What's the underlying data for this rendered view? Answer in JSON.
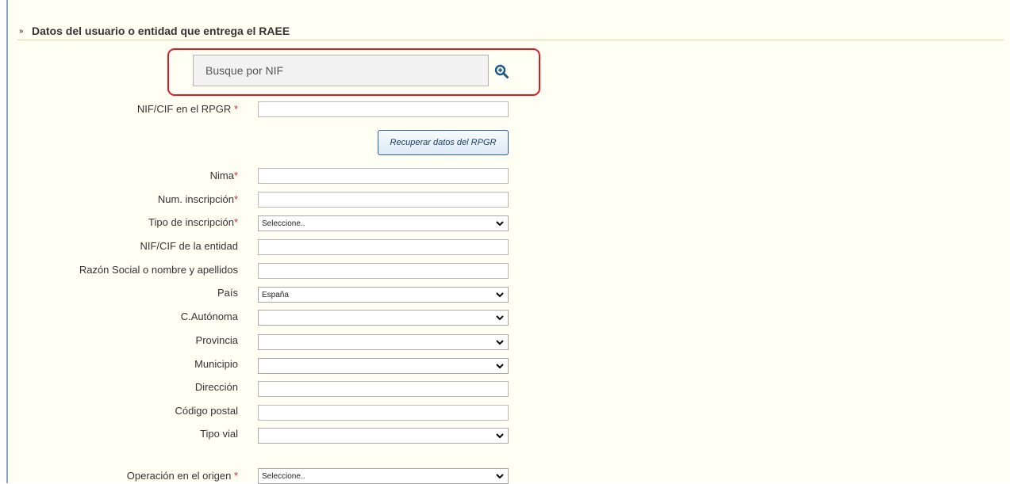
{
  "section": {
    "title": "Datos del usuario o entidad que entrega el RAEE"
  },
  "search": {
    "placeholder": "Busque por NIF"
  },
  "fields": {
    "nif_rpgr": {
      "label": "NIF/CIF en el RPGR",
      "req": "*",
      "value": ""
    },
    "recover_button": "Recuperar datos del RPGR",
    "nima": {
      "label": "Nima",
      "req": "*",
      "value": ""
    },
    "num_inscripcion": {
      "label": "Num. inscripción",
      "req": "*",
      "value": ""
    },
    "tipo_inscripcion": {
      "label": "Tipo de inscripción",
      "req": "*",
      "value": "Seleccione.."
    },
    "nif_entidad": {
      "label": "NIF/CIF de la entidad",
      "value": ""
    },
    "razon_social": {
      "label": "Razón Social o nombre y apellidos",
      "value": ""
    },
    "pais": {
      "label": "País",
      "value": "España"
    },
    "c_autonoma": {
      "label": "C.Autónoma",
      "value": ""
    },
    "provincia": {
      "label": "Provincia",
      "value": ""
    },
    "municipio": {
      "label": "Municipio",
      "value": ""
    },
    "direccion": {
      "label": "Dirección",
      "value": ""
    },
    "codigo_postal": {
      "label": "Código postal",
      "value": ""
    },
    "tipo_vial": {
      "label": "Tipo vial",
      "value": ""
    },
    "operacion_origen": {
      "label": "Operación en el origen",
      "req": "*",
      "value": "Seleccione.."
    }
  },
  "colors": {
    "required": "#d6242b",
    "highlight": "#e01b22",
    "panel_bg": "#fffff4",
    "accent": "#1c5a8c"
  }
}
